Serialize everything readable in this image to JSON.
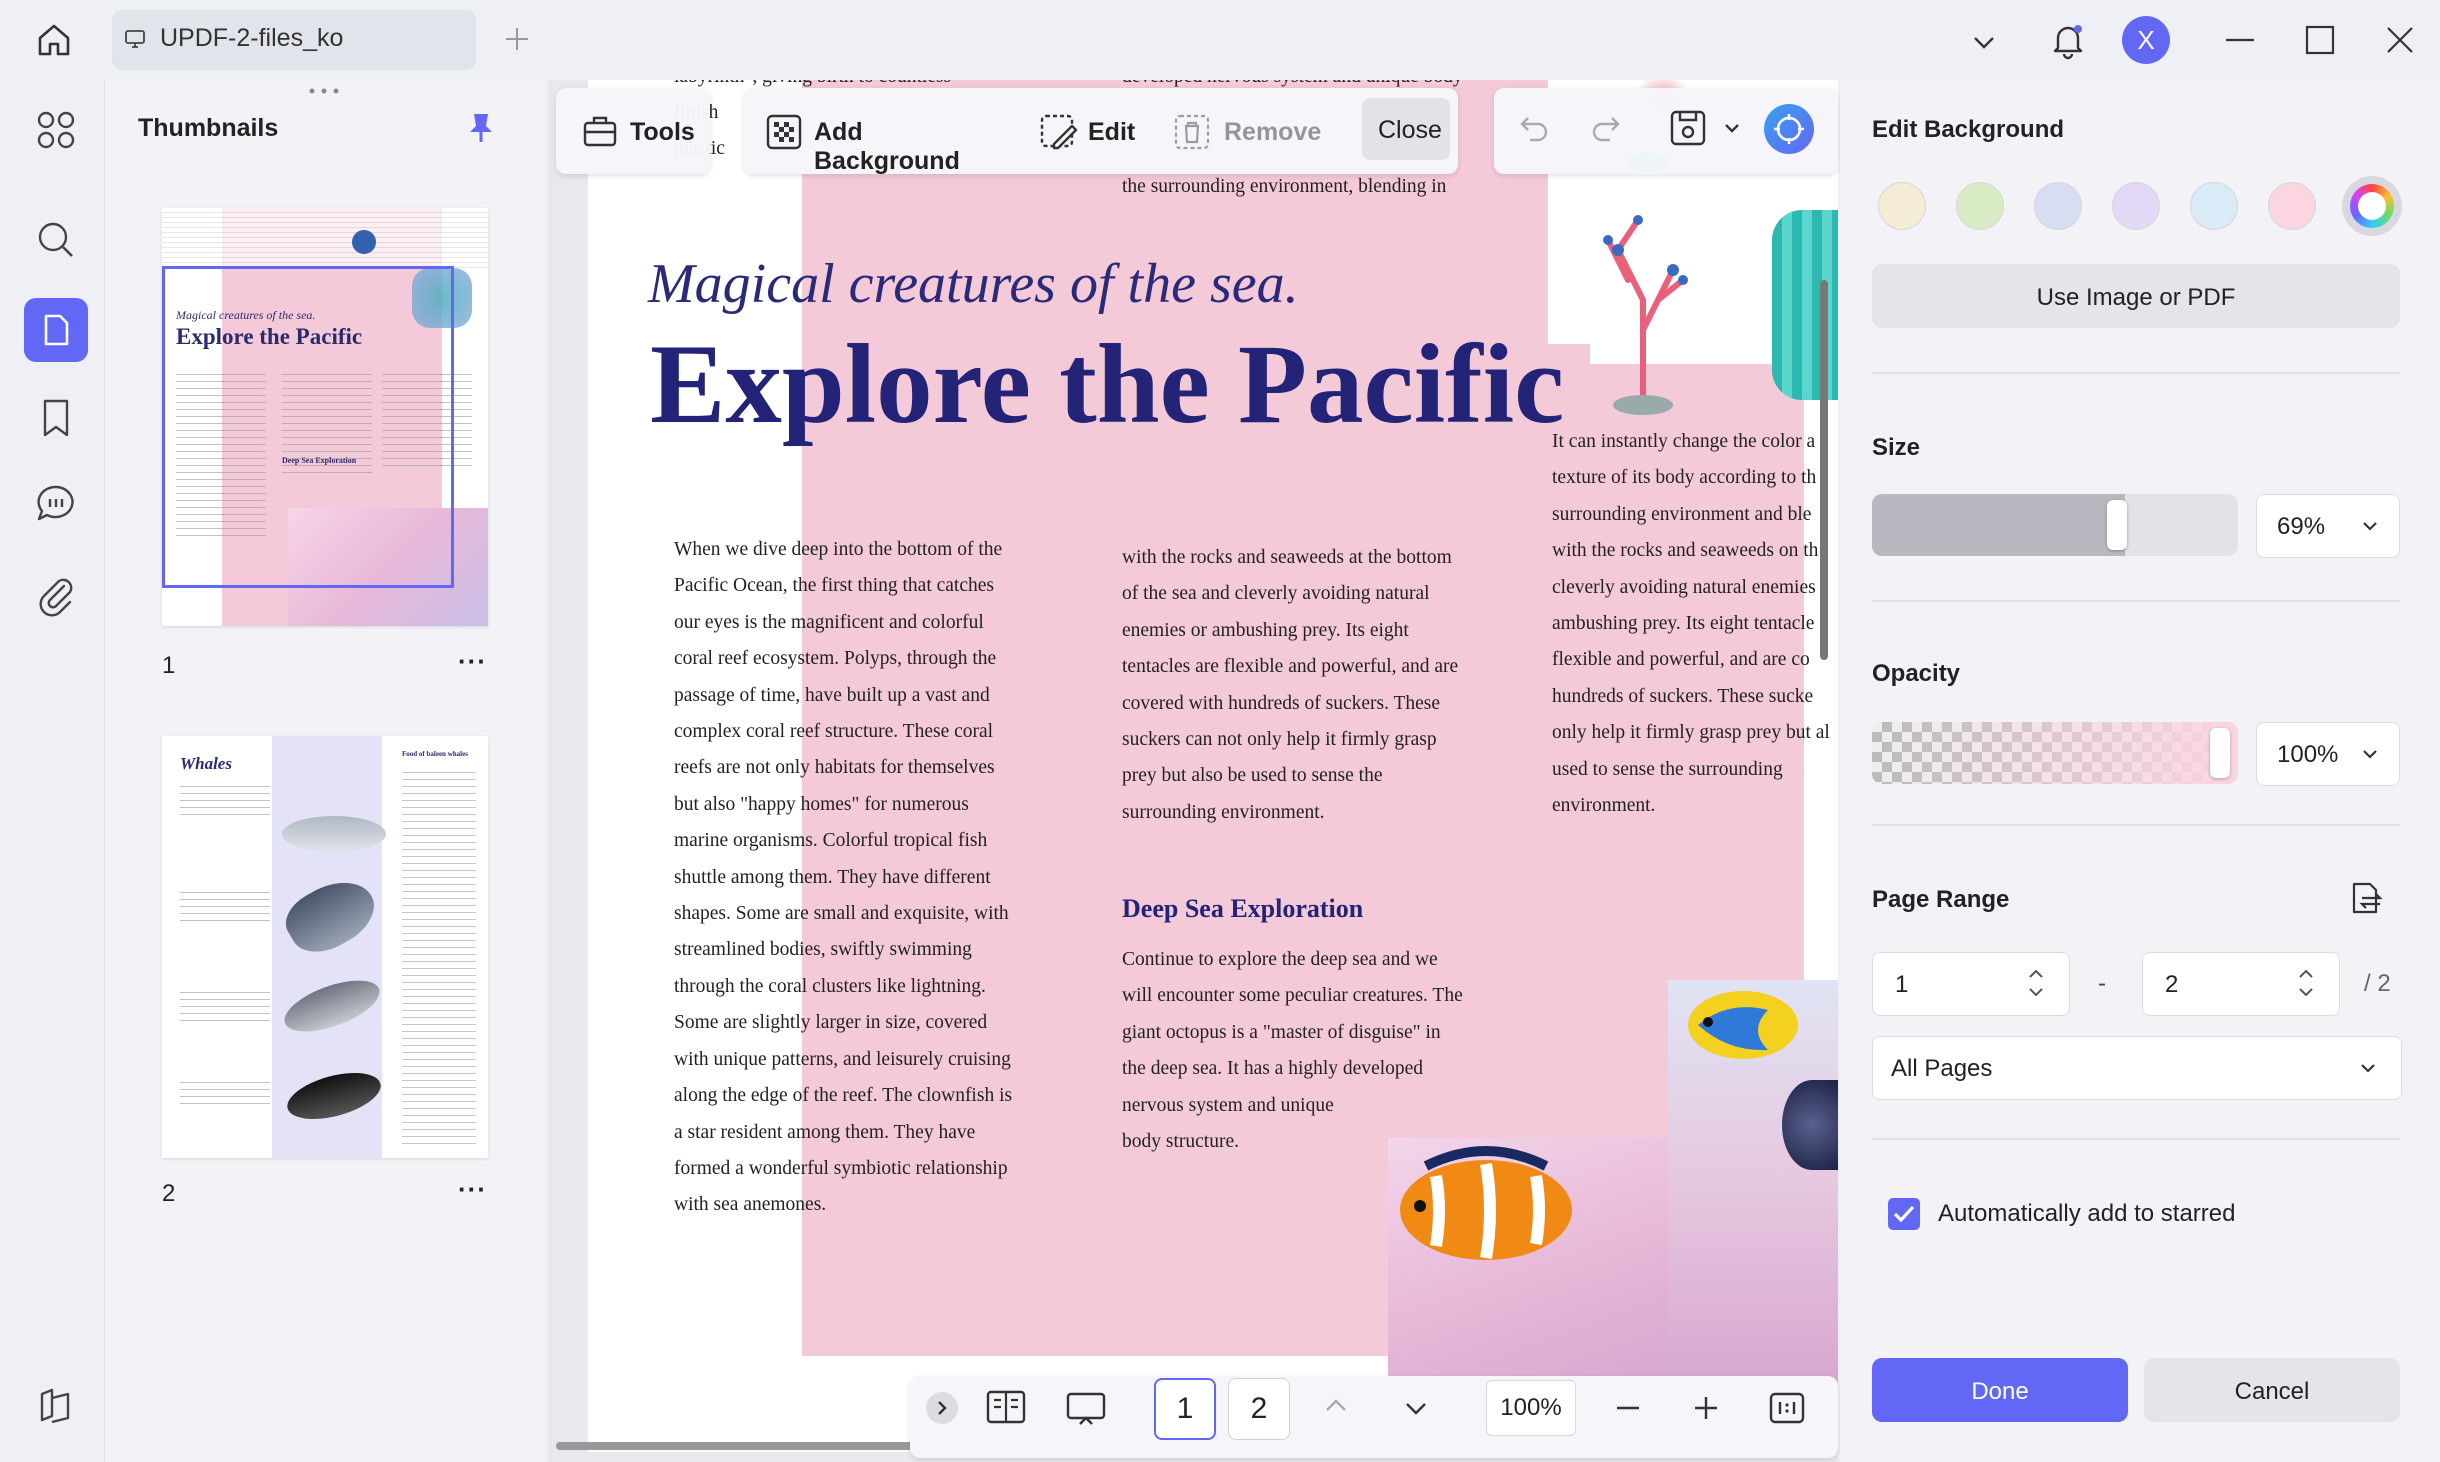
{
  "titlebar": {
    "tab_label": "UPDF-2-files_ko",
    "avatar_letter": "X"
  },
  "thumbnails": {
    "title": "Thumbnails",
    "pages": [
      {
        "number": "1",
        "title": "Explore the Pacific",
        "subtitle": "Magical creatures of the sea.",
        "section": "Deep Sea Exploration"
      },
      {
        "number": "2",
        "title": "Whales",
        "side_heading": "Food of baleen whales"
      }
    ],
    "more_label": "···"
  },
  "toolbar": {
    "tools": "Tools",
    "add_background": "Add Background",
    "edit": "Edit",
    "remove": "Remove",
    "close": "Close"
  },
  "document": {
    "top_fragment_left": "labyrinth\", giving birth to countless",
    "top_fragment_left2": "finish",
    "top_fragment_left3": "plastic",
    "top_fragment_mid": "developed nervous system and unique body",
    "top_fragment_mid2": "the surrounding environment, blending in",
    "subtitle": "Magical creatures of the sea.",
    "title": "Explore the Pacific",
    "col1": [
      "When we dive deep into the bottom of the",
      "Pacific Ocean, the first thing that catches",
      "our eyes is the magnificent and colorful",
      "coral reef ecosystem. Polyps, through the",
      "passage of time, have built up a vast and",
      "complex coral reef structure. These coral",
      "reefs are not only habitats for themselves",
      "but also \"happy homes\" for numerous",
      "marine organisms. Colorful tropical fish",
      "shuttle among them. They have different",
      "shapes. Some are small and exquisite, with",
      "streamlined bodies, swiftly swimming",
      "through the coral clusters like lightning.",
      "Some are slightly larger in size, covered",
      "with unique patterns, and leisurely cruising",
      "along the edge of the reef. The clownfish is",
      "a star resident among them. They have",
      "formed a wonderful symbiotic relationship",
      "with sea anemones."
    ],
    "col2": [
      "with the rocks and seaweeds at the bottom",
      "of the sea and cleverly avoiding natural",
      "enemies or ambushing prey. Its eight",
      "tentacles are flexible and powerful, and are",
      "covered with hundreds of suckers. These",
      "suckers can not only help it firmly grasp",
      "prey but also be used to sense the",
      "surrounding environment."
    ],
    "section_heading": "Deep Sea Exploration",
    "col2b": [
      "Continue to explore the deep sea and we",
      "will encounter some peculiar creatures. The",
      "giant octopus is a \"master of disguise\" in",
      "the deep sea. It has a highly developed",
      "nervous system and unique",
      "body structure."
    ],
    "col3": [
      "It can instantly change the color a",
      "texture of its body according to th",
      "surrounding environment and ble",
      "with the rocks and seaweeds on th",
      "cleverly avoiding natural enemies",
      "ambushing prey. Its eight tentacle",
      "flexible and powerful, and are co",
      "hundreds of suckers. These sucke",
      "only help it firmly grasp prey but al",
      "used to sense the surrounding",
      "environment."
    ]
  },
  "bottombar": {
    "page1": "1",
    "page2": "2",
    "zoom": "100%"
  },
  "panel": {
    "title": "Edit Background",
    "swatches": [
      "#f5ecd6",
      "#d8ebc4",
      "#d8ddf2",
      "#e4d8f7",
      "#d8ebf7",
      "#fbd5e0"
    ],
    "use_image": "Use Image or PDF",
    "size_label": "Size",
    "size_value": "69%",
    "size_fraction": 0.69,
    "opacity_label": "Opacity",
    "opacity_value": "100%",
    "opacity_fraction": 1.0,
    "page_range_label": "Page Range",
    "range_from": "1",
    "range_sep": "-",
    "range_to": "2",
    "range_total": "/ 2",
    "pages_option": "All Pages",
    "auto_star_label": "Automatically add to starred",
    "auto_star_checked": true,
    "done": "Done",
    "cancel": "Cancel",
    "accent": "#6367f5"
  }
}
